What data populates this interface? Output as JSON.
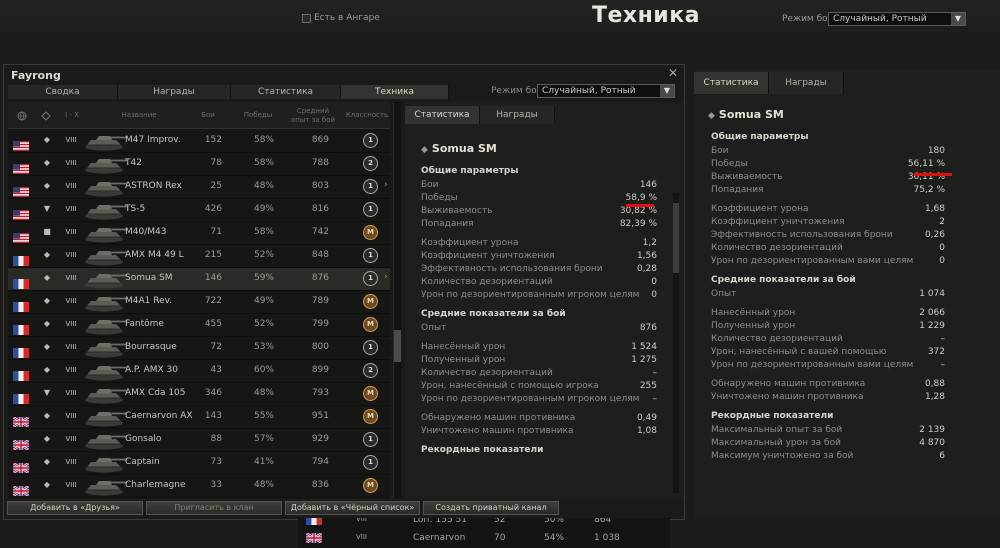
{
  "header": {
    "hangar_checkbox_label": "Есть в Ангаре",
    "title": "Техника",
    "battle_mode_label": "Режим боя:",
    "battle_mode_value": "Случайный, Ротный"
  },
  "window": {
    "title": "Fayrong",
    "tabs": [
      "Сводка",
      "Награды",
      "Статистика",
      "Техника"
    ],
    "active_tab": "Техника",
    "battle_mode_label": "Режим боя:",
    "battle_mode_value": "Случайный, Ротный",
    "columns": {
      "tier": "I - X",
      "name": "Название",
      "battles": "Бои",
      "wins": "Победы",
      "avg_xp": "Средний опыт за бой",
      "class": "Классность"
    },
    "vehicles": [
      {
        "flag": "us",
        "type": "◆",
        "tier": "VIII",
        "name": "M47 Improv.",
        "battles": "152",
        "wins": "58%",
        "xp": "869",
        "badge": "1",
        "badge_kind": "n"
      },
      {
        "flag": "us",
        "type": "◆",
        "tier": "VIII",
        "name": "T42",
        "battles": "78",
        "wins": "58%",
        "xp": "788",
        "badge": "2",
        "badge_kind": "n"
      },
      {
        "flag": "us",
        "type": "◆",
        "tier": "VIII",
        "name": "ASTRON Rex",
        "battles": "25",
        "wins": "48%",
        "xp": "803",
        "badge": "1",
        "badge_kind": "n",
        "chevron": "›"
      },
      {
        "flag": "us",
        "type": "▼",
        "tier": "VIII",
        "name": "TS-5",
        "battles": "426",
        "wins": "49%",
        "xp": "816",
        "badge": "1",
        "badge_kind": "n"
      },
      {
        "flag": "us",
        "type": "■",
        "tier": "VIII",
        "name": "M40/M43",
        "battles": "71",
        "wins": "58%",
        "xp": "742",
        "badge": "M",
        "badge_kind": "m"
      },
      {
        "flag": "fr",
        "type": "◆",
        "tier": "VIII",
        "name": "AMX M4 49 L",
        "battles": "215",
        "wins": "52%",
        "xp": "848",
        "badge": "1",
        "badge_kind": "n"
      },
      {
        "flag": "fr",
        "type": "◆",
        "tier": "VIII",
        "name": "Somua SM",
        "battles": "146",
        "wins": "59%",
        "xp": "876",
        "badge": "1",
        "badge_kind": "n",
        "chevron": "›",
        "selected": true
      },
      {
        "flag": "fr",
        "type": "◆",
        "tier": "VIII",
        "name": "M4A1 Rev.",
        "battles": "722",
        "wins": "49%",
        "xp": "789",
        "badge": "M",
        "badge_kind": "m"
      },
      {
        "flag": "fr",
        "type": "◆",
        "tier": "VIII",
        "name": "Fantôme",
        "battles": "455",
        "wins": "52%",
        "xp": "799",
        "badge": "M",
        "badge_kind": "m"
      },
      {
        "flag": "fr",
        "type": "◆",
        "tier": "VIII",
        "name": "Bourrasque",
        "battles": "72",
        "wins": "53%",
        "xp": "800",
        "badge": "1",
        "badge_kind": "n"
      },
      {
        "flag": "fr",
        "type": "◆",
        "tier": "VIII",
        "name": "A.P. AMX 30",
        "battles": "43",
        "wins": "60%",
        "xp": "899",
        "badge": "2",
        "badge_kind": "n"
      },
      {
        "flag": "fr",
        "type": "▼",
        "tier": "VIII",
        "name": "AMX Cda 105",
        "battles": "346",
        "wins": "48%",
        "xp": "793",
        "badge": "M",
        "badge_kind": "m"
      },
      {
        "flag": "uk",
        "type": "◆",
        "tier": "VIII",
        "name": "Caernarvon AX",
        "battles": "143",
        "wins": "55%",
        "xp": "951",
        "badge": "M",
        "badge_kind": "m"
      },
      {
        "flag": "uk",
        "type": "◆",
        "tier": "VIII",
        "name": "Gonsalo",
        "battles": "88",
        "wins": "57%",
        "xp": "929",
        "badge": "1",
        "badge_kind": "n"
      },
      {
        "flag": "uk",
        "type": "◆",
        "tier": "VIII",
        "name": "Captain",
        "battles": "73",
        "wins": "41%",
        "xp": "794",
        "badge": "1",
        "badge_kind": "n"
      },
      {
        "flag": "uk",
        "type": "◆",
        "tier": "VIII",
        "name": "Charlemagne",
        "battles": "33",
        "wins": "48%",
        "xp": "836",
        "badge": "M",
        "badge_kind": "m"
      }
    ],
    "buttons": {
      "add_friend": "Добавить в «Друзья»",
      "invite_clan": "Пригласить в клан",
      "blacklist": "Добавить в «Чёрный список»",
      "private_channel": "Создать приватный канал"
    }
  },
  "inner_stats": {
    "tabs": [
      "Статистика",
      "Награды"
    ],
    "vehicle": "Somua SM",
    "general_title": "Общие параметры",
    "general": [
      {
        "label": "Бои",
        "value": "146"
      },
      {
        "label": "Победы",
        "value": "58,9 %"
      },
      {
        "label": "Выживаемость",
        "value": "30,82 %"
      },
      {
        "label": "Попадания",
        "value": "82,39 %"
      }
    ],
    "coeffs": [
      {
        "label": "Коэффициент урона",
        "value": "1,2"
      },
      {
        "label": "Коэффициент уничтожения",
        "value": "1,56"
      },
      {
        "label": "Эффективность использования брони",
        "value": "0,28"
      },
      {
        "label": "Количество дезориентаций",
        "value": "0"
      },
      {
        "label": "Урон по дезориентированным игроком целям",
        "value": "0"
      }
    ],
    "avg_title": "Средние показатели за бой",
    "avg_xp": [
      {
        "label": "Опыт",
        "value": "876"
      }
    ],
    "avg_damage": [
      {
        "label": "Нанесённый урон",
        "value": "1 524"
      },
      {
        "label": "Полученный урон",
        "value": "1 275"
      },
      {
        "label": "Количество дезориентаций",
        "value": "–"
      },
      {
        "label": "Урон, нанесённый с помощью игрока",
        "value": "255"
      },
      {
        "label": "Урон по дезориентированным игроком целям",
        "value": "–"
      }
    ],
    "avg_spot": [
      {
        "label": "Обнаружено машин противника",
        "value": "0,49"
      },
      {
        "label": "Уничтожено машин противника",
        "value": "1,08"
      }
    ],
    "records_title": "Рекордные показатели"
  },
  "bg_stats": {
    "tabs": [
      "Статистика",
      "Награды"
    ],
    "vehicle": "Somua SM",
    "general_title": "Общие параметры",
    "general": [
      {
        "label": "Бои",
        "value": "180"
      },
      {
        "label": "Победы",
        "value": "56,11 %"
      },
      {
        "label": "Выживаемость",
        "value": "36,11 %"
      },
      {
        "label": "Попадания",
        "value": "75,2 %"
      }
    ],
    "coeffs": [
      {
        "label": "Коэффициент урона",
        "value": "1,68"
      },
      {
        "label": "Коэффициент уничтожения",
        "value": "2"
      },
      {
        "label": "Эффективность использования брони",
        "value": "0,26"
      },
      {
        "label": "Количество дезориентаций",
        "value": "0"
      },
      {
        "label": "Урон по дезориентированным вами целям",
        "value": "0"
      }
    ],
    "avg_title": "Средние показатели за бой",
    "avg_xp": [
      {
        "label": "Опыт",
        "value": "1 074"
      }
    ],
    "avg_damage": [
      {
        "label": "Нанесённый урон",
        "value": "2 066"
      },
      {
        "label": "Полученный урон",
        "value": "1 229"
      },
      {
        "label": "Количество дезориентаций",
        "value": "–"
      },
      {
        "label": "Урон, нанесённый с вашей помощью",
        "value": "372"
      },
      {
        "label": "Урон по дезориентированным вами целям",
        "value": "–"
      }
    ],
    "avg_spot": [
      {
        "label": "Обнаружено машин противника",
        "value": "0,88"
      },
      {
        "label": "Уничтожено машин противника",
        "value": "1,28"
      }
    ],
    "records_title": "Рекордные показатели",
    "records": [
      {
        "label": "Максимальный опыт за бой",
        "value": "2 139"
      },
      {
        "label": "Максимальный урон за бой",
        "value": "4 870"
      },
      {
        "label": "Максимум уничтожено за бой",
        "value": "6"
      }
    ]
  },
  "peek_rows": [
    {
      "tier": "VIII",
      "name": "Lorr. 155 51",
      "battles": "52",
      "wins": "50%",
      "xp": "864"
    },
    {
      "tier": "VIII",
      "name": "Caernarvon",
      "battles": "70",
      "wins": "54%",
      "xp": "1 038"
    }
  ],
  "colors": {
    "highlight_underline": "#e01010",
    "chevron": "#d38a2a"
  }
}
